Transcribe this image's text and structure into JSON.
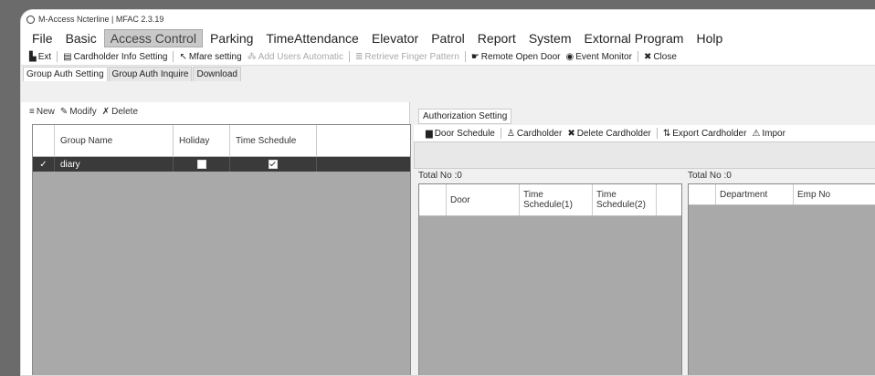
{
  "window": {
    "title": "M-Access Ncterline | MFAC 2.3.19"
  },
  "menu": [
    "File",
    "Basic",
    "Access Control",
    "Parking",
    "TimeAttendance",
    "Elevator",
    "Patrol",
    "Report",
    "System",
    "Extornal Program",
    "Holp"
  ],
  "menu_active": "Access Control",
  "toolbar": {
    "exit": "Ext",
    "cardholder_info": "Cardholder Info Setting",
    "mifare": "Mfare setting",
    "add_users": "Add Users Automatic",
    "retrieve_finger": "Retrieve Finger Pattern",
    "remote_open": "Remote Open Door",
    "event_monitor": "Event Monitor",
    "close": "Close"
  },
  "tabs": [
    "Group Auth Setting",
    "Group Auth Inquire",
    "Download"
  ],
  "left_toolbar": {
    "new": "New",
    "modify": "Modify",
    "delete": "Delete"
  },
  "group_table": {
    "columns": [
      "Group Name",
      "Holiday",
      "Time Schedule"
    ],
    "rows": [
      {
        "marker": "✓",
        "name": "diary",
        "holiday": false,
        "time_schedule": true
      }
    ]
  },
  "right": {
    "tab": "Authorization Setting",
    "toolbar": {
      "door_schedule": "Door Schedule",
      "cardholder": "Cardholder",
      "delete_cardholder": "Delete Cardholder",
      "export_cardholder": "Export Cardholder",
      "import": "Impor"
    },
    "total_left": "Total No :0",
    "total_right": "Total No :0",
    "door_columns": [
      "Door",
      "Time Schedule(1)",
      "Time Schedule(2)"
    ],
    "cardholder_columns": [
      "Department",
      "Emp No"
    ]
  }
}
